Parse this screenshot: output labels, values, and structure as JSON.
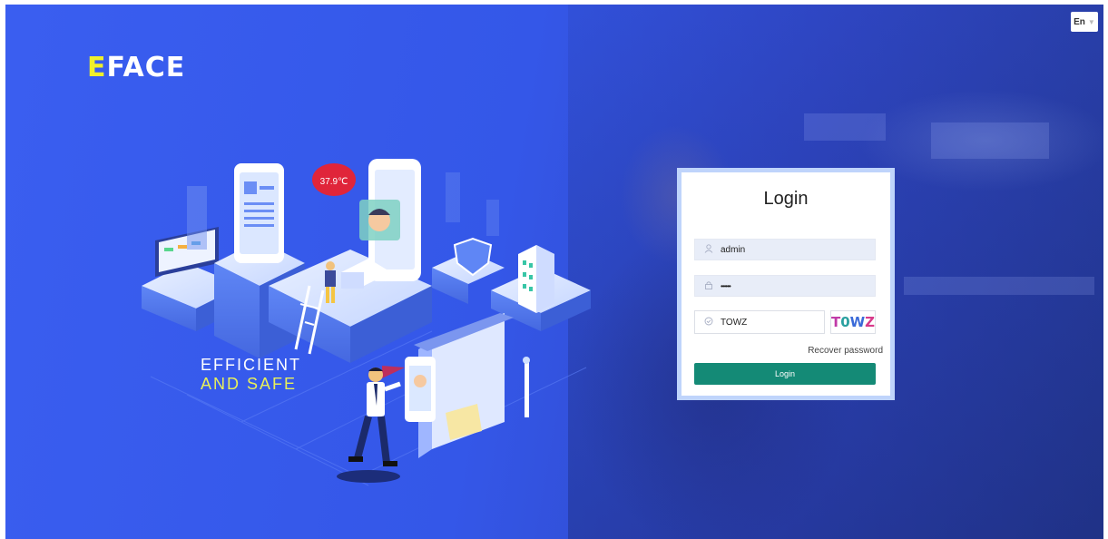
{
  "brand": {
    "logo_first": "E",
    "logo_rest": "FACE",
    "accent": "#f0f02a"
  },
  "language": {
    "selected": "En",
    "caret_icon": "chevron-down-icon"
  },
  "slogan": {
    "line1": "EFFICIENT",
    "line2": "AND SAFE"
  },
  "illustration": {
    "temperature_bubble": "37.9℃"
  },
  "login": {
    "title": "Login",
    "username": {
      "value": "admin",
      "icon": "user-icon"
    },
    "password": {
      "value": "••••••",
      "icon": "lock-icon"
    },
    "captcha": {
      "value": "TOWZ",
      "icon": "shield-check-icon",
      "image_chars": [
        "T",
        "0",
        "W",
        "Z"
      ]
    },
    "recover_label": "Recover password",
    "submit_label": "Login",
    "submit_color": "#148a76"
  },
  "colors": {
    "background": "#3457e8",
    "card_frame": "#bfd4fb"
  }
}
